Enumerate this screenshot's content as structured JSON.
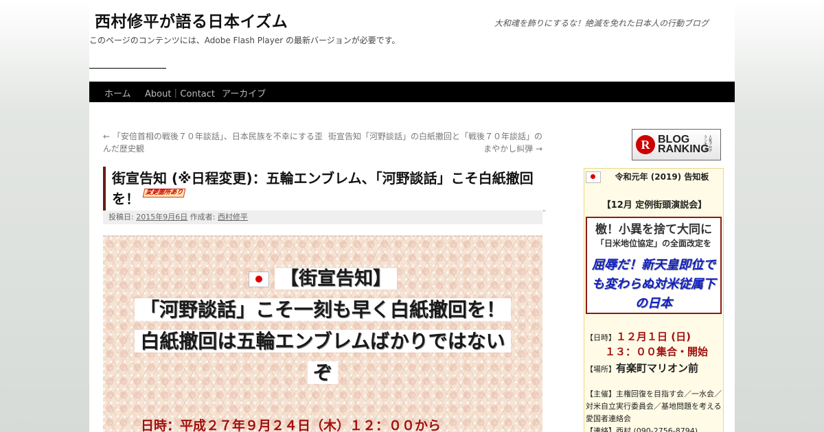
{
  "site": {
    "title": "西村修平が語る日本イズム",
    "description": "大和魂を飾りにするな！絶滅を免れた日本人の行動ブログ",
    "flash_notice": "このページのコンテンツには、Adobe Flash Player の最新バージョンが必要です。"
  },
  "nav": {
    "items": [
      {
        "label": "ホーム"
      },
      {
        "label": "About｜Contact"
      },
      {
        "label": "アーカイブ"
      }
    ]
  },
  "post_nav": {
    "prev": "← 「安倍首相の戦後７０年談話」、日本民族を不幸にする歪んだ歴史観",
    "next": "街宣告知「河野談話」の白紙撤回と「戦後７０年談話」のまやかし糾弾 →"
  },
  "entry": {
    "title": "街宣告知 (※日程変更)：五輪エンブレム、「河野談話」こそ白紙撤回を！",
    "badge": "変更箇所あり",
    "meta_posted_label": "投稿日:",
    "meta_date": "2015年9月6日",
    "meta_author_label": "作成者:",
    "meta_author": "西村修平"
  },
  "hero": {
    "line1": "【街宣告知】",
    "line2": "「河野談話」こそ一刻も早く白紙撤回を！",
    "line3": "白紙撤回は五輪エンブレムばかりではない",
    "line4": "ぞ",
    "date": "日時：平成２７年９月２４日（木）１２：００から"
  },
  "sidebar": {
    "ranking": {
      "big": "BLOG",
      "big2": "RANKING",
      "small": "人気ブログランキング",
      "mark": "R"
    },
    "notice": {
      "title": "令和元年 (2019) 告知板",
      "sub": "【12月 定例街頭演説会】",
      "box_head": "檄！小異を捨て大同に",
      "box_sub": "「日米地位協定」の全面改定を",
      "box_blue": "屈辱だ！新天皇即位でも変わらぬ対米従属下の日本",
      "date_label": "【日時】",
      "date_val": "１２月１日 (日)",
      "time_val": "１３：００集合・開始",
      "place_label": "【場所】",
      "place_val": "有楽町マリオン前",
      "sponsor": "【主催】主権回復を目指す会／一水会／対米自立実行委員会／基地問題を考える愛国者連絡会",
      "contact": "【連絡】西村 (090-2756-8794)"
    }
  },
  "colors": {
    "accent": "#6b1c12",
    "date_red": "#a01010",
    "blue": "#1020c0",
    "nav_bg": "#000000"
  }
}
